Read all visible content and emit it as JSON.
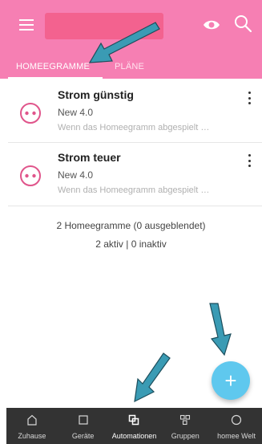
{
  "header": {
    "tabs": [
      {
        "label": "HOMEEGRAMME",
        "active": true
      },
      {
        "label": "PLÄNE",
        "active": false
      }
    ]
  },
  "colors": {
    "header_bg": "#f67fb3",
    "accent": "#e0558b",
    "fab": "#5fc8ee",
    "annotation_arrow": "#3a9bb4",
    "nav_bg": "#333333"
  },
  "items": [
    {
      "name": "Strom günstig",
      "version": "New 4.0",
      "description": "Wenn das Homeegramm abgespielt wird",
      "icon": "homeegram-icon"
    },
    {
      "name": "Strom teuer",
      "version": "New 4.0",
      "description": "Wenn das Homeegramm abgespielt wird",
      "icon": "homeegram-icon"
    }
  ],
  "summary": {
    "count_line": "2 Homeegramme (0 ausgeblendet)",
    "status_line": "2 aktiv | 0 inaktiv"
  },
  "fab": {
    "label": "+"
  },
  "bottom_nav": {
    "items": [
      {
        "label": "Zuhause",
        "icon": "home-icon"
      },
      {
        "label": "Geräte",
        "icon": "device-icon"
      },
      {
        "label": "Automationen",
        "icon": "automation-icon",
        "active": true
      },
      {
        "label": "Gruppen",
        "icon": "groups-icon"
      },
      {
        "label": "homee Welt",
        "icon": "world-icon"
      }
    ]
  }
}
